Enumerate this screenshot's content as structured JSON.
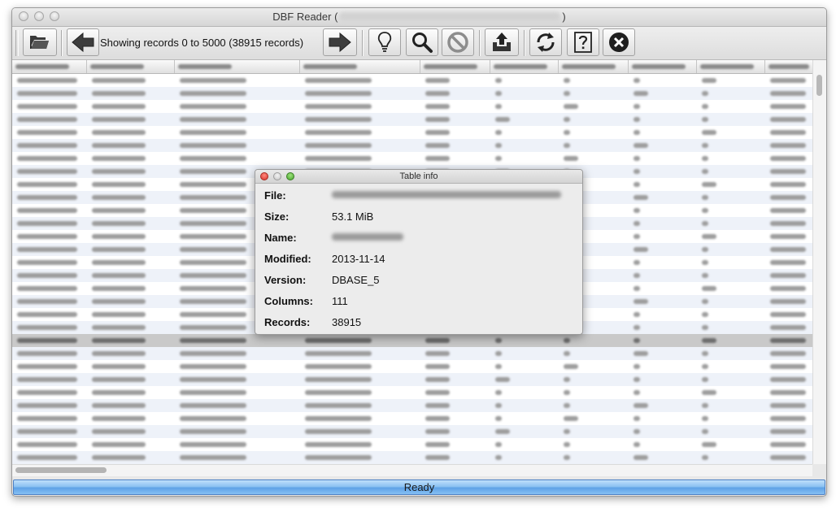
{
  "window": {
    "title": "DBF Reader (",
    "title_end": ")"
  },
  "toolbar": {
    "records_label": "Showing records 0 to 5000 (38915 records)",
    "buttons": [
      "open-folder-icon",
      "arrow-left-icon",
      "arrow-right-icon",
      "lightbulb-icon",
      "search-icon",
      "no-entry-icon",
      "export-icon",
      "refresh-icon",
      "help-icon",
      "close-icon"
    ]
  },
  "status": {
    "text": "Ready",
    "color": "#5ea2e6"
  },
  "dialog": {
    "title": "Table info",
    "fields": [
      {
        "label": "File:",
        "value": ""
      },
      {
        "label": "Size:",
        "value": "53.1 MiB"
      },
      {
        "label": "Name:",
        "value": ""
      },
      {
        "label": "Modified:",
        "value": "2013-11-14"
      },
      {
        "label": "Version:",
        "value": "DBASE_5"
      },
      {
        "label": "Columns:",
        "value": "111"
      },
      {
        "label": "Records:",
        "value": "38915"
      }
    ]
  }
}
